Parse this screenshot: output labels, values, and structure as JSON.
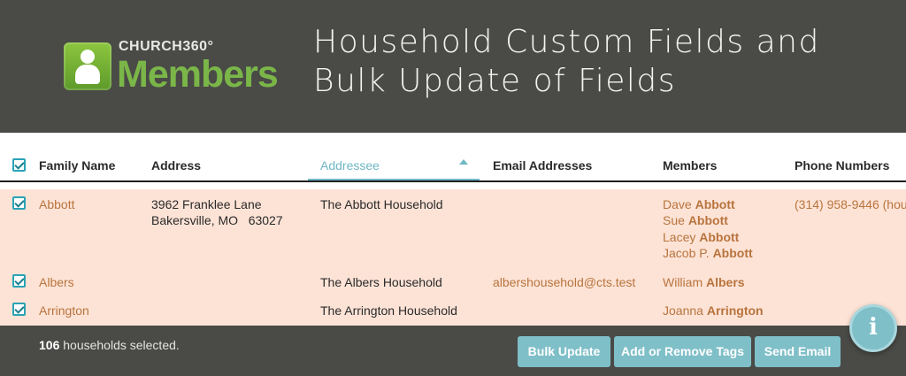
{
  "header": {
    "logo_top": "CHURCH360°",
    "logo_word": "Members",
    "title_line1": "Household Custom Fields and",
    "title_line2": "Bulk Update of Fields"
  },
  "table": {
    "columns": [
      "Family Name",
      "Address",
      "Addressee",
      "Email Addresses",
      "Members",
      "Phone Numbers"
    ],
    "sorted_column": "Addressee",
    "rows": [
      {
        "family": "Abbott",
        "address1": "3962 Franklee Lane",
        "address2": "Bakersville, MO   63027",
        "addressee": "The Abbott Household",
        "email": "",
        "members": [
          {
            "first": "Dave",
            "last": "Abbott"
          },
          {
            "first": "Sue",
            "last": "Abbott"
          },
          {
            "first": "Lacey",
            "last": "Abbott"
          },
          {
            "first": "Jacob P.",
            "last": "Abbott"
          }
        ],
        "phone": "(314) 958-9446 (hou"
      },
      {
        "family": "Albers",
        "addressee": "The Albers Household",
        "email": "albershousehold@cts.test",
        "members": [
          {
            "first": "William",
            "last": "Albers"
          }
        ]
      },
      {
        "family": "Arrington",
        "addressee": "The Arrington Household",
        "members": [
          {
            "first": "Joanna",
            "last": "Arrington"
          }
        ]
      }
    ]
  },
  "footer": {
    "selected_count": "106",
    "selected_suffix": " households selected.",
    "buttons": {
      "bulk_update": "Bulk Update",
      "tags": "Add or Remove Tags",
      "email": "Send Email"
    },
    "info_glyph": "i"
  },
  "colors": {
    "accent": "#7fbfc8",
    "link": "#b8743d",
    "row_highlight": "#fde3d6",
    "header_bg": "#4a4a47",
    "logo_green": "#7ab648"
  }
}
